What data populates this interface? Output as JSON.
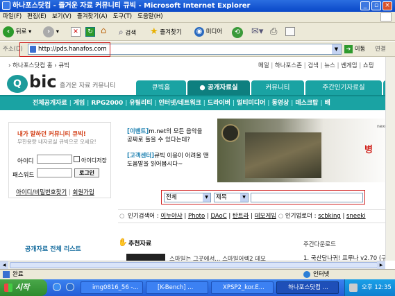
{
  "window": {
    "title": "하나포스닷컴 - 즐거운 자료 커뮤니티 큐빅 - Microsoft Internet Explorer"
  },
  "menu": [
    "파일(F)",
    "편집(E)",
    "보기(V)",
    "즐겨찾기(A)",
    "도구(T)",
    "도움말(H)"
  ],
  "toolbar": {
    "back": "뒤로",
    "search": "검색",
    "favorites": "즐겨찾기",
    "media": "미디어"
  },
  "address": {
    "label": "주소(D)",
    "url": "http://pds.hanafos.com",
    "go": "이동",
    "links": "연결"
  },
  "site": {
    "breadcrumb": "› 하나포스닷컴 홈 › 큐빅",
    "toplinks": [
      "메일",
      "하나포스존",
      "검색",
      "뉴스",
      "쎈게임",
      "쇼핑"
    ],
    "logo": "bic",
    "tagline": "즐거운 자료 커뮤니티",
    "tabs": [
      "큐빅홈",
      "공개자료실",
      "커뮤니티",
      "주간인기자료실"
    ],
    "nav": [
      "전체공개자료",
      "게임",
      "RPG2000",
      "유틸리티",
      "인터넷/네트워크",
      "드라이버",
      "멀티미디어",
      "동영상",
      "데스크탑",
      "배"
    ],
    "login": {
      "title": "내가 말하던 커뮤니티 큐빅!",
      "subtitle": "무한용량 내자료실 큐빅으로 오세요!",
      "id_label": "아이디",
      "pw_label": "패스워드",
      "save_id": "아이디저장",
      "login_btn": "로그인",
      "find": "아이디/비밀번호찾기",
      "join": "회원가입"
    },
    "notices": [
      {
        "tag": "[이벤트]",
        "text": "m.net의 모든 음악을 공짜로 들을 수 있다는데?"
      },
      {
        "tag": "[고객센터]",
        "text": "큐빅 이용이 어려울 땐 도움말을 읽어봅시다~"
      }
    ],
    "banner": {
      "text": "병",
      "corner": "nexon"
    },
    "search": {
      "category": "전체",
      "field": "제목"
    },
    "popular": {
      "label": "인기검색어 :",
      "items": [
        "이누야샤",
        "Photo",
        "DAoC",
        "탄트라",
        "데모게임"
      ],
      "uploader_label": "인기업로더 :",
      "uploaders": [
        "scbking",
        "sneeki"
      ]
    },
    "section_left": "공개자료 전체 리스트",
    "section_mid": "추천자료",
    "section_mid_item": "스마일는 그곳에서... 스마일어렉2 데모",
    "section_right": "주간다운로드",
    "section_right_item": "1. 국산당나귀! 프루나 v2.70 (구"
  },
  "status": {
    "left": "완료",
    "right": "인터넷"
  },
  "taskbar": {
    "start": "시작",
    "tasks": [
      "img0816_56 -...",
      "[K-Bench] ...",
      "XPSP2_kor.E...",
      "하나포스닷컴 ..."
    ],
    "clock": "오후 12:35"
  }
}
